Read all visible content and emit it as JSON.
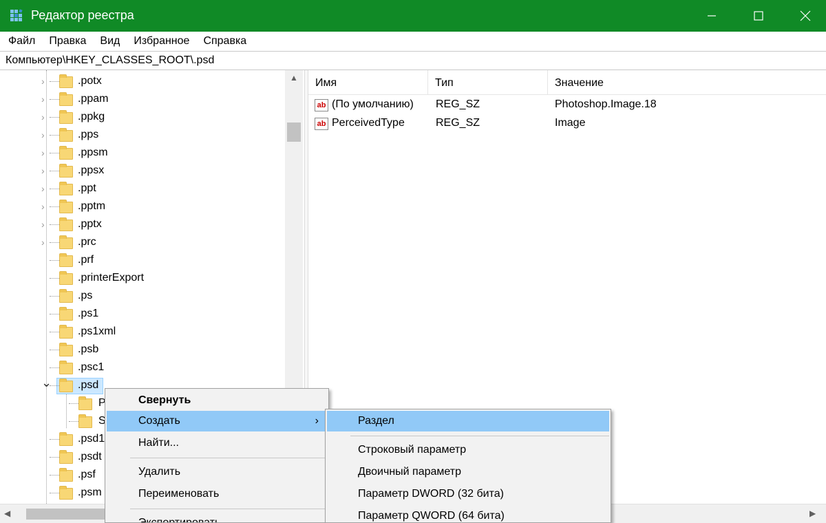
{
  "window": {
    "title": "Редактор реестра",
    "controls": [
      "—",
      "☐",
      "✕"
    ]
  },
  "menu": [
    "Файл",
    "Правка",
    "Вид",
    "Избранное",
    "Справка"
  ],
  "address": "Компьютер\\HKEY_CLASSES_ROOT\\.psd",
  "tree": {
    "items": [
      {
        "label": ".potx",
        "expandable": true
      },
      {
        "label": ".ppam",
        "expandable": true
      },
      {
        "label": ".ppkg",
        "expandable": true
      },
      {
        "label": ".pps",
        "expandable": true
      },
      {
        "label": ".ppsm",
        "expandable": true
      },
      {
        "label": ".ppsx",
        "expandable": true
      },
      {
        "label": ".ppt",
        "expandable": true
      },
      {
        "label": ".pptm",
        "expandable": true
      },
      {
        "label": ".pptx",
        "expandable": true
      },
      {
        "label": ".prc",
        "expandable": true
      },
      {
        "label": ".prf",
        "expandable": false
      },
      {
        "label": ".printerExport",
        "expandable": false
      },
      {
        "label": ".ps",
        "expandable": false
      },
      {
        "label": ".ps1",
        "expandable": false
      },
      {
        "label": ".ps1xml",
        "expandable": false
      },
      {
        "label": ".psb",
        "expandable": false
      },
      {
        "label": ".psc1",
        "expandable": false
      },
      {
        "label": ".psd",
        "expandable": true,
        "expanded": true,
        "selected": true
      },
      {
        "label": "P",
        "child": true
      },
      {
        "label": "S",
        "child": true
      },
      {
        "label": ".psd1",
        "expandable": false
      },
      {
        "label": ".psdt",
        "expandable": false
      },
      {
        "label": ".psf",
        "expandable": false
      },
      {
        "label": ".psm",
        "expandable": false
      }
    ]
  },
  "list": {
    "columns": [
      "Имя",
      "Тип",
      "Значение"
    ],
    "rows": [
      {
        "name": "(По умолчанию)",
        "type": "REG_SZ",
        "value": "Photoshop.Image.18",
        "icon": "ab"
      },
      {
        "name": "PerceivedType",
        "type": "REG_SZ",
        "value": "Image",
        "icon": "ab"
      }
    ]
  },
  "context_menu": {
    "items": [
      {
        "label": "Свернуть",
        "bold": true
      },
      {
        "label": "Создать",
        "highlighted": true,
        "submenu_arrow": "›"
      },
      {
        "label": "Найти..."
      },
      {
        "label": "Удалить"
      },
      {
        "label": "Переименовать"
      },
      {
        "label": "Экспортировать"
      }
    ]
  },
  "submenu": {
    "items": [
      {
        "label": "Раздел",
        "highlighted": true
      },
      {
        "label": "Строковый параметр"
      },
      {
        "label": "Двоичный параметр"
      },
      {
        "label": "Параметр DWORD (32 бита)"
      },
      {
        "label": "Параметр QWORD (64 бита)"
      }
    ]
  },
  "colors": {
    "titlebar": "#108a26",
    "menu_highlight": "#91c9f7",
    "selection": "#cce8ff",
    "folder": "#f8d775"
  }
}
